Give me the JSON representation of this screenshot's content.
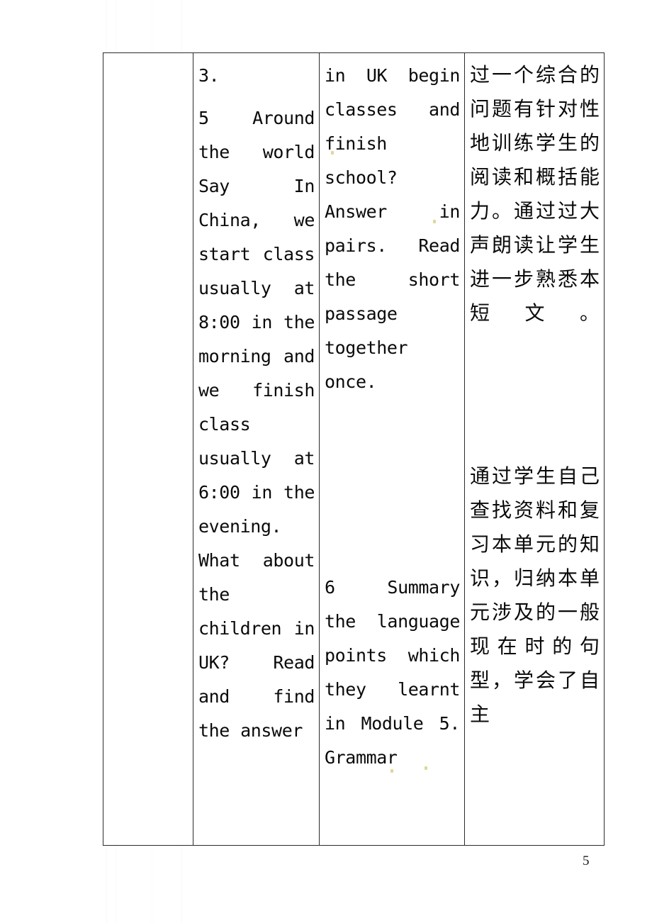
{
  "document": {
    "page_number": "5",
    "table": {
      "columns": [
        {
          "name": "column-blank",
          "content": ""
        },
        {
          "name": "column-teaching-steps",
          "content": ""
        },
        {
          "name": "column-activities",
          "content": ""
        },
        {
          "name": "column-design-intent",
          "content": ""
        }
      ],
      "cells": {
        "blank_cell": "",
        "steps_heading": "3.",
        "steps_body": "5    Around the world Say  In China, we start class usually at 8:00 in the morning and we finish class usually at 6:00 in the evening. What about the children in UK? Read and find the answer",
        "activities_body_1": "in UK begin classes and finish school? Answer in pairs. Read the short passage together once.",
        "activities_body_2": "6 Summary the language points which they learnt in Module 5. Grammar",
        "intent_body_1": "过一个综合的问题有针对性地训练学生的阅读和概括能力。通过过大声朗读让学生进一步熟悉本短文。",
        "intent_body_2": "通过学生自己查找资料和复习本单元的知识，归纳本单元涉及的一般现在时的句型，学会了自主"
      }
    }
  }
}
